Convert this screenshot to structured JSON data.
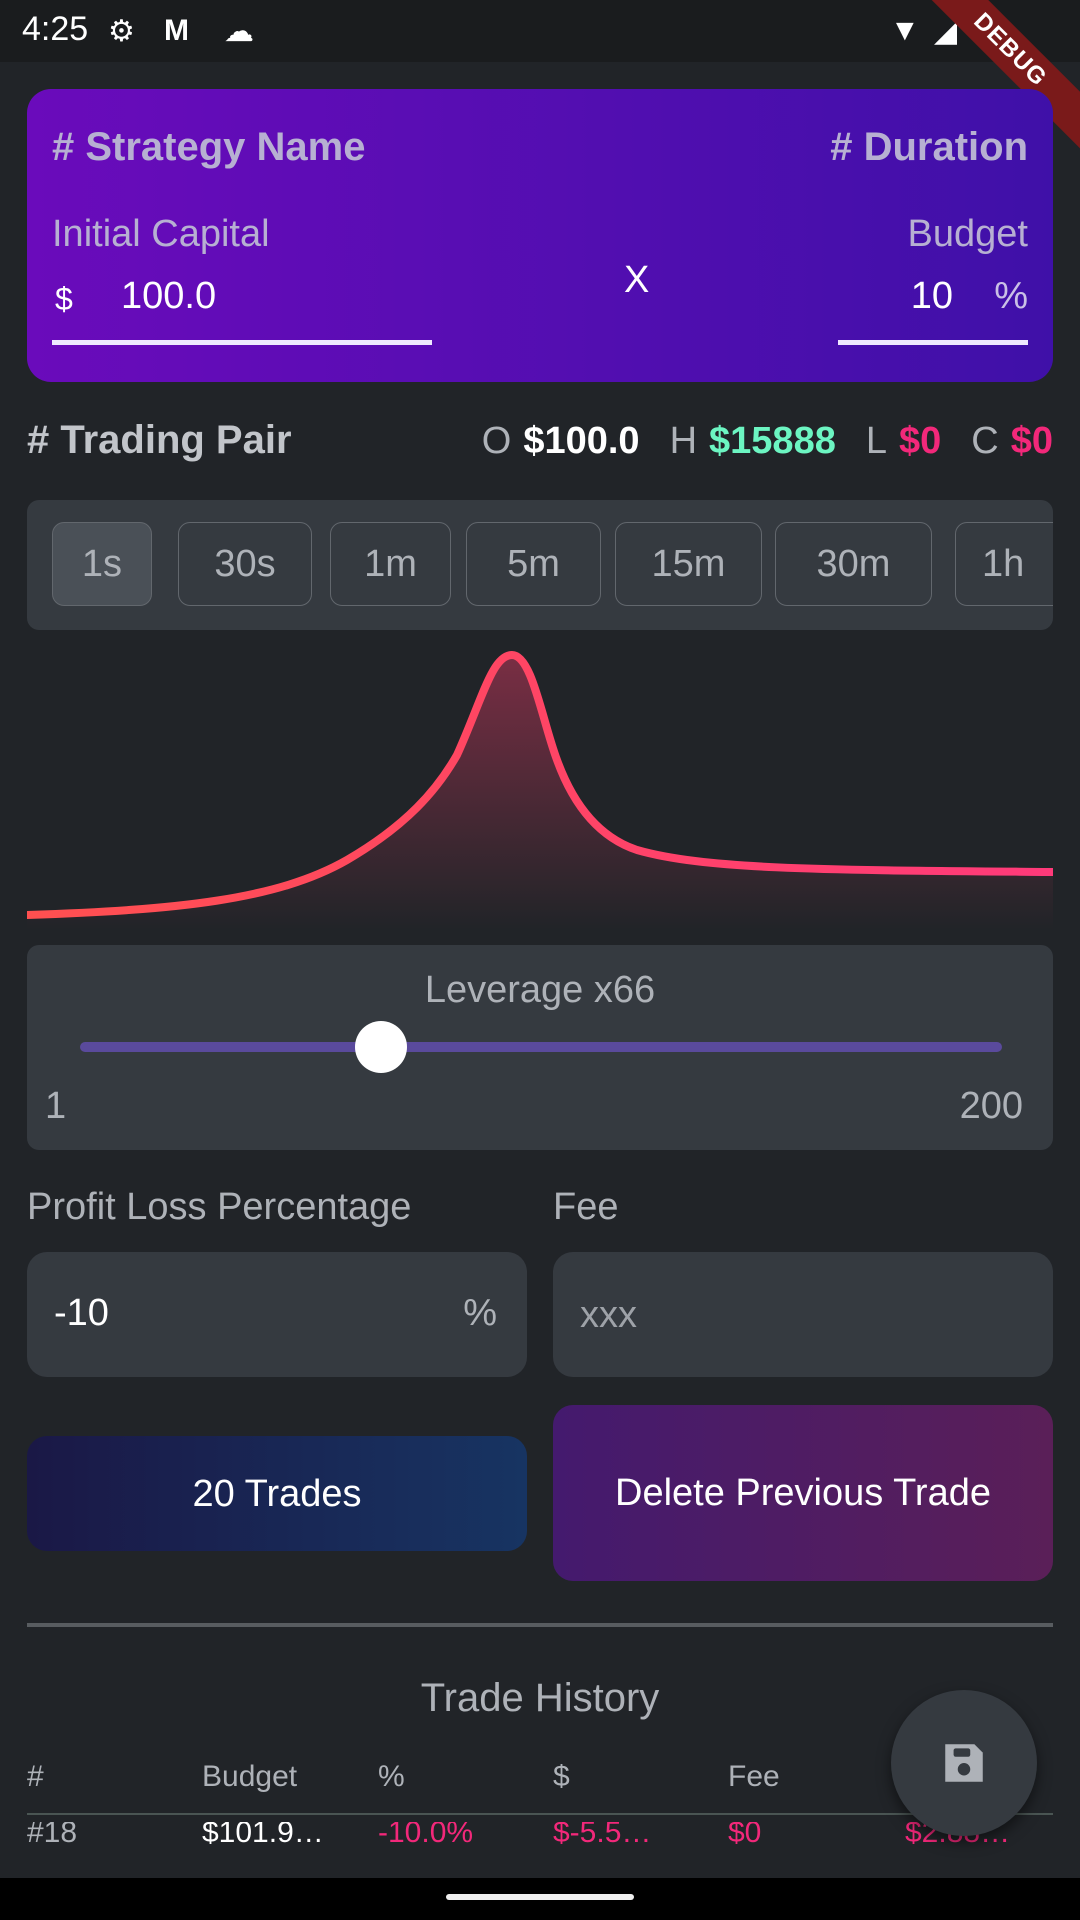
{
  "status_bar": {
    "time": "4:25",
    "icons": [
      "settings-icon",
      "gmail-icon",
      "cloud-icon",
      "wifi-icon",
      "signal-icon",
      "battery-icon"
    ]
  },
  "debug_banner": "DEBUG",
  "strategy_card": {
    "strategy_name": "# Strategy Name",
    "duration": "# Duration",
    "initial_capital_label": "Initial Capital",
    "currency": "$",
    "initial_capital": "100.0",
    "multiply": "X",
    "budget_label": "Budget",
    "budget": "10",
    "budget_unit": "%"
  },
  "trading_pair": {
    "title": "# Trading Pair",
    "o_label": "O",
    "o_value": "$100.0",
    "h_label": "H",
    "h_value": "$15888",
    "l_label": "L",
    "l_value": "$0",
    "c_label": "C",
    "c_value": "$0"
  },
  "intervals": {
    "items": [
      "1s",
      "30s",
      "1m",
      "5m",
      "15m",
      "30m",
      "1h"
    ],
    "selected": "1s"
  },
  "leverage": {
    "label": "Leverage x66",
    "value": 66,
    "min": "1",
    "max": "200"
  },
  "profit_loss": {
    "label": "Profit Loss Percentage",
    "value": "-10",
    "unit": "%"
  },
  "fee": {
    "label": "Fee",
    "placeholder": "xxx"
  },
  "buttons": {
    "trades": "20 Trades",
    "delete": "Delete Previous Trade"
  },
  "history": {
    "title": "Trade History",
    "columns": [
      "#",
      "Budget",
      "%",
      "$",
      "Fee"
    ],
    "rows": [
      [
        "#18",
        "$101.9…",
        "-10.0%",
        "$-5.5…",
        "$0",
        "$2.88…"
      ]
    ]
  },
  "colors": {
    "green": "#6cf5c2",
    "red": "#f2287a",
    "line": "#ff3d6e",
    "accent": "#5a4a9c"
  }
}
